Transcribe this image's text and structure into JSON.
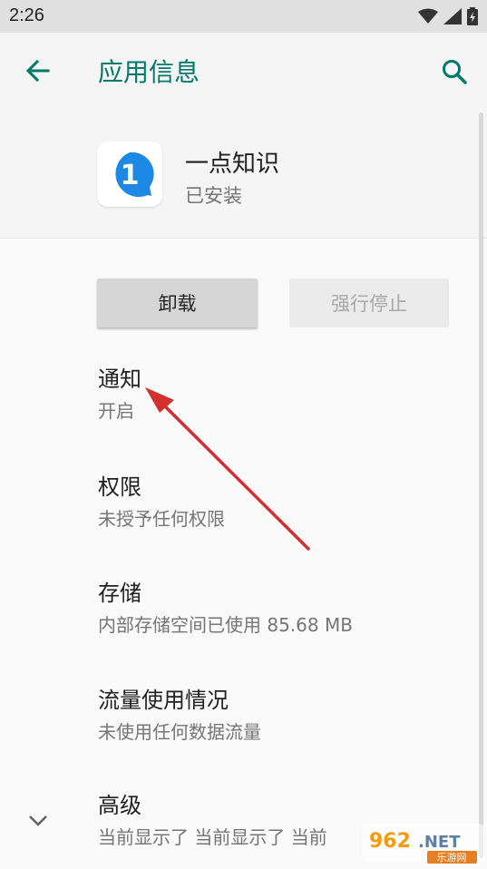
{
  "status_bar": {
    "time": "2:26",
    "icons": [
      "wifi-icon",
      "signal-icon",
      "battery-icon"
    ]
  },
  "app_bar": {
    "title": "应用信息",
    "icons": [
      "back-arrow-icon",
      "search-icon"
    ],
    "accent_color": "#00796b"
  },
  "app_header": {
    "name": "一点知识",
    "status": "已安装",
    "icon": "one-dianzhishi-app-icon",
    "icon_color": "#1e88e5",
    "icon_glyph": "1"
  },
  "buttons": {
    "uninstall": "卸载",
    "force_stop": "强行停止"
  },
  "preferences": [
    {
      "title": "通知",
      "summary": "开启"
    },
    {
      "title": "权限",
      "summary": "未授予任何权限"
    },
    {
      "title": "存储",
      "summary": "内部存储空间已使用 85.68 MB"
    },
    {
      "title": "流量使用情况",
      "summary": "未使用任何数据流量"
    },
    {
      "title": "高级",
      "summary": "当前显示了 当前显示了 当前"
    }
  ],
  "watermark": {
    "brand": "962.NET",
    "subtext": "乐游网"
  },
  "annotation": {
    "type": "red-arrow",
    "color": "#d32f2f"
  }
}
